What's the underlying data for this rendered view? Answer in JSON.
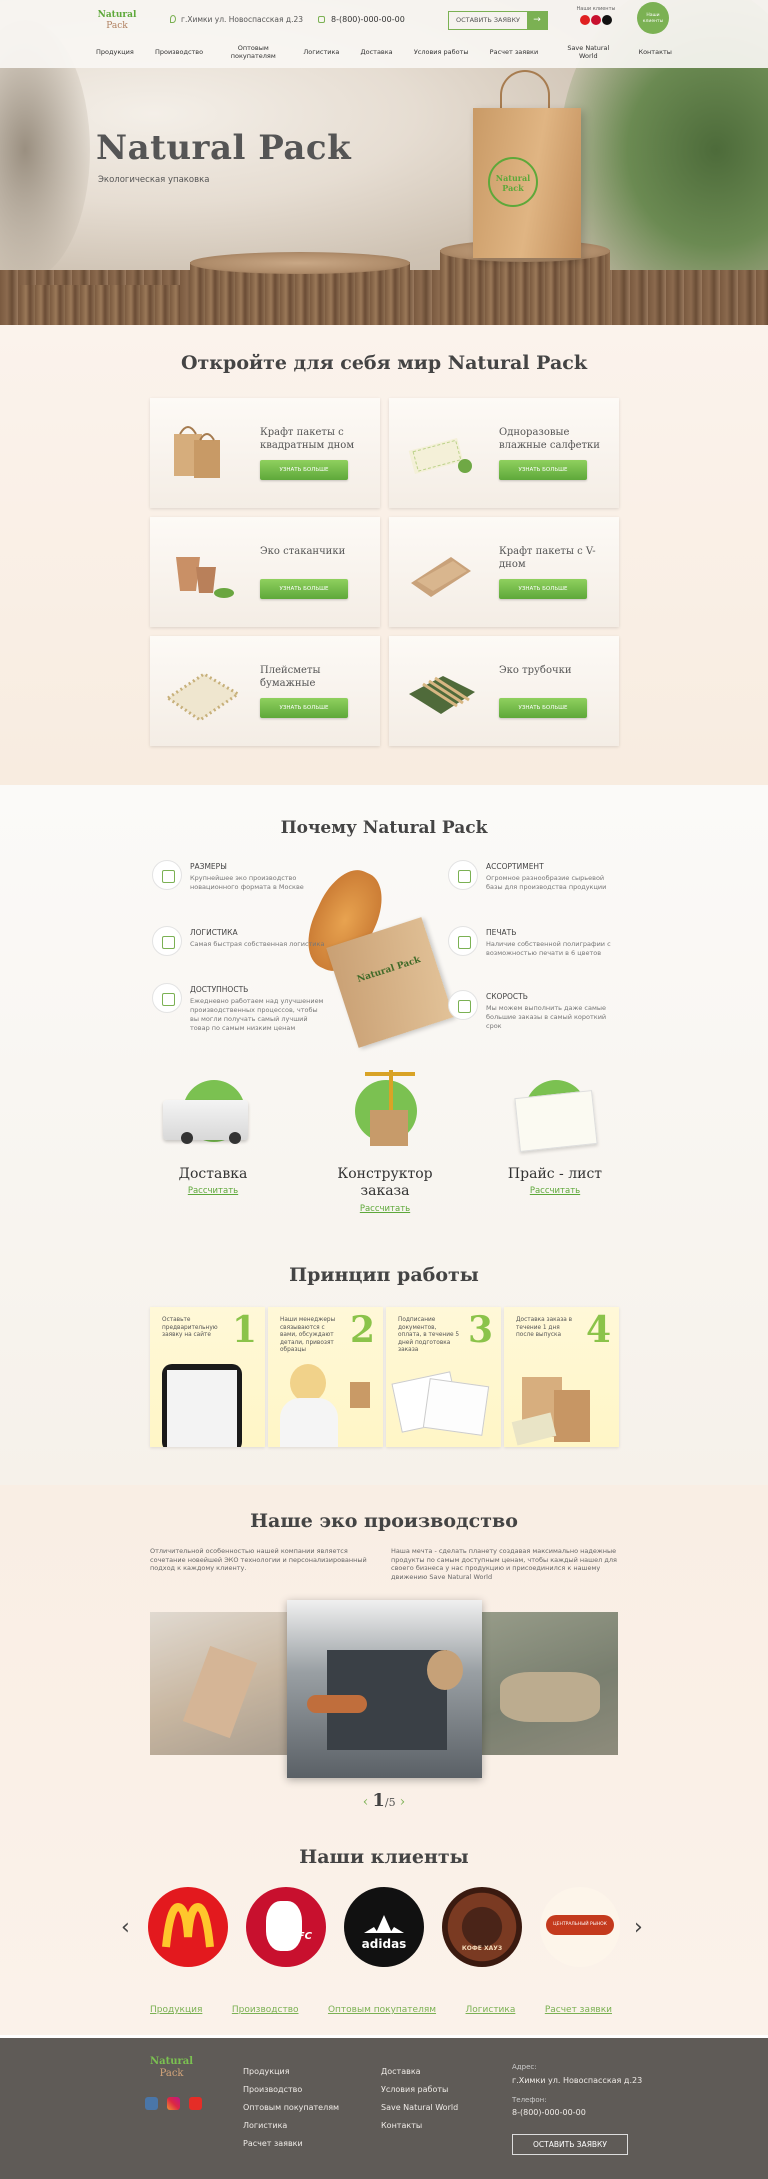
{
  "brand": {
    "logo_line1": "Natural",
    "logo_line2": "Pack",
    "green": "#7bb153",
    "dark_footer": "#5f5b57"
  },
  "header": {
    "address": "г.Химки ул. Новоспасская д.23",
    "phone": "8-(800)-000-00-00",
    "request_label": "ОСТАВИТЬ ЗАЯВКУ",
    "partners_label": "Наши клиенты",
    "round_button": "Наши клиенты",
    "nav": [
      "Продукция",
      "Производство",
      "Оптовым покупателям",
      "Логистика",
      "Доставка",
      "Условия работы",
      "Расчет заявки",
      "Save Natural World",
      "Контакты"
    ]
  },
  "hero": {
    "title": "Natural Pack",
    "subtitle": "Экологическая упаковка",
    "bag_logo": "Natural Pack"
  },
  "products": {
    "heading": "Откройте для себя мир Natural Pack",
    "button_label": "УЗНАТЬ БОЛЬШЕ",
    "items": [
      {
        "title": "Крафт пакеты с квадратным дном",
        "icon": "kraft-bags-icon"
      },
      {
        "title": "Одноразовые влажные салфетки",
        "icon": "wet-wipes-icon"
      },
      {
        "title": "Эко стаканчики",
        "icon": "eco-cups-icon"
      },
      {
        "title": "Крафт пакеты с V-дном",
        "icon": "v-bottom-bags-icon"
      },
      {
        "title": "Плейсметы бумажные",
        "icon": "placemats-icon"
      },
      {
        "title": "Эко трубочки",
        "icon": "straws-icon"
      }
    ]
  },
  "why": {
    "heading": "Почему Natural Pack",
    "features": [
      {
        "title": "РАЗМЕРЫ",
        "desc": "Крупнейшее эко производство новационного формата в Москве"
      },
      {
        "title": "ЛОГИСТИКА",
        "desc": "Самая быстрая собственная логистика"
      },
      {
        "title": "ДОСТУПНОСТЬ",
        "desc": "Ежедневно работаем над улучшением производственных процессов, чтобы вы могли получать самый лучший товар по самым низким ценам"
      },
      {
        "title": "АССОРТИМЕНТ",
        "desc": "Огромное разнообразие сырьевой базы для производства продукции"
      },
      {
        "title": "ПЕЧАТЬ",
        "desc": "Наличие собственной полиграфии с возможностью печати в 6 цветов"
      },
      {
        "title": "СКОРОСТЬ",
        "desc": "Мы можем выполнить даже самые большие заказы в самый короткий срок"
      }
    ],
    "actions": [
      {
        "title": "Доставка",
        "link": "Рассчитать"
      },
      {
        "title": "Конструктор заказа",
        "link": "Рассчитать"
      },
      {
        "title": "Прайс - лист",
        "link": "Рассчитать"
      }
    ]
  },
  "steps": {
    "heading": "Принцип работы",
    "items": [
      {
        "num": "1",
        "text": "Оставьте предварительную заявку на сайте"
      },
      {
        "num": "2",
        "text": "Наши менеджеры связываются с вами, обсуждают детали, привозят образцы"
      },
      {
        "num": "3",
        "text": "Подписание документов, оплата, в течение 5 дней подготовка заказа"
      },
      {
        "num": "4",
        "text": "Доставка заказа в течение 1 дня после выпуска"
      }
    ]
  },
  "production": {
    "heading": "Наше эко производство",
    "text_left": "Отличительной особенностью нашей компании является сочетание новейшей ЭКО технологии и персонализированный подход к каждому клиенту.",
    "text_right": "Наша мечта - сделать планету создавая максимально надежные продукты по самым доступным ценам, чтобы каждый нашел для своего бизнеса у нас продукцию и присоединился к нашему движению Save Natural World",
    "pager_current": "1",
    "pager_total": "/5",
    "prev": "‹",
    "next": "›"
  },
  "clients": {
    "heading": "Наши клиенты",
    "logos": [
      {
        "name": "McDonald's",
        "icon": "mcdonalds-logo-icon"
      },
      {
        "name": "KFC",
        "icon": "kfc-logo-icon"
      },
      {
        "name": "adidas",
        "icon": "adidas-logo-icon"
      },
      {
        "name": "КОФЕ ХАУЗ",
        "icon": "coffee-house-logo-icon"
      },
      {
        "name": "ЦЕНТРАЛЬНЫЙ РЫНОК",
        "icon": "central-market-logo-icon"
      }
    ],
    "prev": "‹",
    "next": "›"
  },
  "footer_links": [
    "Продукция",
    "Производство",
    "Оптовым покупателям",
    "Логистика",
    "Расчет заявки"
  ],
  "footer": {
    "col1": [
      "Продукция",
      "Производство",
      "Оптовым покупателям",
      "Логистика",
      "Расчет заявки"
    ],
    "col2": [
      "Доставка",
      "Условия работы",
      "Save Natural World",
      "Контакты"
    ],
    "address_label": "Адрес:",
    "address": "г.Химки ул. Новоспасская д.23",
    "phone_label": "Телефон:",
    "phone": "8-(800)-000-00-00",
    "button": "ОСТАВИТЬ ЗАЯВКУ",
    "socials": [
      "vk-icon",
      "instagram-icon",
      "youtube-icon"
    ]
  }
}
